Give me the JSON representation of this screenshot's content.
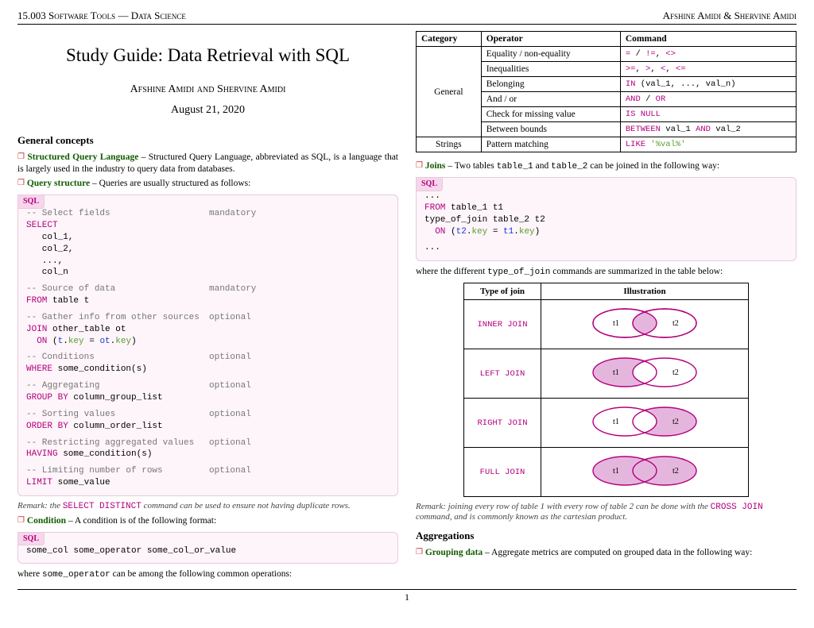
{
  "header": {
    "left": "15.003 Software Tools — Data Science",
    "right": "Afshine Amidi & Shervine Amidi"
  },
  "title": "Study Guide: Data Retrieval with SQL",
  "authors": "Afshine Amidi and Shervine Amidi",
  "date": "August 21, 2020",
  "sections": {
    "general": "General concepts",
    "agg": "Aggregations"
  },
  "sql_badge": "SQL",
  "entries": {
    "sql_def_term": "Structured Query Language",
    "sql_def_text": " – Structured Query Language, abbreviated as SQL, is a language that is largely used in the industry to query data from databases.",
    "qstruct_term": "Query structure",
    "qstruct_text": " – Queries are usually structured as follows:",
    "cond_term": "Condition",
    "cond_text": " – A condition is of the following format:",
    "cond_after": "where some_operator can be among the following common operations:",
    "joins_term": "Joins",
    "joins_text_a": " – Two tables ",
    "joins_text_b": " and ",
    "joins_text_c": " can be joined in the following way:",
    "joins_after_a": "where the different ",
    "joins_after_b": " commands are summarized in the table below:",
    "group_term": "Grouping data",
    "group_text": " – Aggregate metrics are computed on grouped data in the following way:"
  },
  "remarks": {
    "distinct_a": "Remark: the ",
    "distinct_b": "SELECT DISTINCT",
    "distinct_c": " command can be used to ensure not having duplicate rows.",
    "cross_a": "Remark: joining every row of table 1 with every row of table 2 can be done with the ",
    "cross_b": "CROSS JOIN",
    "cross_c": " command, and is commonly known as the cartesian product."
  },
  "query_code": {
    "c1": "-- Select fields",
    "a1": "mandatory",
    "l1": "SELECT",
    "l2": "   col_1,",
    "l3": "   col_2,",
    "l4": "   ...,",
    "l5": "   col_n",
    "c2": "-- Source of data",
    "a2": "mandatory",
    "l6a": "FROM",
    "l6b": " table t",
    "c3": "-- Gather info from other sources",
    "a3": "optional",
    "l7a": "JOIN",
    "l7b": " other_table ot",
    "l8a": "  ON",
    "l8b": " (",
    "l8c": "t",
    "l8d": ".",
    "l8e": "key",
    "l8f": " = ",
    "l8g": "ot",
    "l8h": ".",
    "l8i": "key",
    "l8j": ")",
    "c4": "-- Conditions",
    "a4": "optional",
    "l9a": "WHERE",
    "l9b": " some_condition(s)",
    "c5": "-- Aggregating",
    "a5": "optional",
    "l10a": "GROUP BY",
    "l10b": " column_group_list",
    "c6": "-- Sorting values",
    "a6": "optional",
    "l11a": "ORDER BY",
    "l11b": " column_order_list",
    "c7": "-- Restricting aggregated values",
    "a7": "optional",
    "l12a": "HAVING",
    "l12b": " some_condition(s)",
    "c8": "-- Limiting number of rows",
    "a8": "optional",
    "l13a": "LIMIT",
    "l13b": " some_value"
  },
  "cond_code": "some_col some_operator some_col_or_value",
  "join_code": {
    "l1": "...",
    "l2a": "FROM",
    "l2b": " table_1 t1",
    "l3": "type_of_join table_2 t2",
    "l4a": "  ON",
    "l4b": " (",
    "l4c": "t2",
    "l4d": ".",
    "l4e": "key",
    "l4f": " = ",
    "l4g": "t1",
    "l4h": ".",
    "l4i": "key",
    "l4j": ")",
    "l5": "..."
  },
  "optable": {
    "h1": "Category",
    "h2": "Operator",
    "h3": "Command",
    "cat1": "General",
    "cat2": "Strings",
    "r": [
      {
        "op": "Equality / non-equality",
        "cmd_parts": [
          "=",
          " / ",
          "!=",
          ", ",
          "<>"
        ]
      },
      {
        "op": "Inequalities",
        "cmd_parts": [
          ">=",
          ", ",
          ">",
          ", ",
          "<",
          ", ",
          "<="
        ]
      },
      {
        "op": "Belonging",
        "cmd_parts": [
          "IN",
          " (val_1, ..., val_n)"
        ]
      },
      {
        "op": "And / or",
        "cmd_parts": [
          "AND",
          " / ",
          "OR"
        ]
      },
      {
        "op": "Check for missing value",
        "cmd_parts": [
          "IS NULL"
        ]
      },
      {
        "op": "Between bounds",
        "cmd_parts": [
          "BETWEEN",
          " val_1 ",
          "AND",
          " val_2"
        ]
      },
      {
        "op": "Pattern matching",
        "cmd_parts": [
          "LIKE",
          " ",
          "'%val%'"
        ]
      }
    ]
  },
  "venn": {
    "h1": "Type of join",
    "h2": "Illustration",
    "t1": "t1",
    "t2": "t2",
    "rows": [
      "INNER JOIN",
      "LEFT JOIN",
      "RIGHT JOIN",
      "FULL JOIN"
    ]
  },
  "inline": {
    "table1": "table_1",
    "table2": "table_2",
    "typeofjoin": "type_of_join",
    "someop": "some_operator"
  },
  "page_number": "1"
}
